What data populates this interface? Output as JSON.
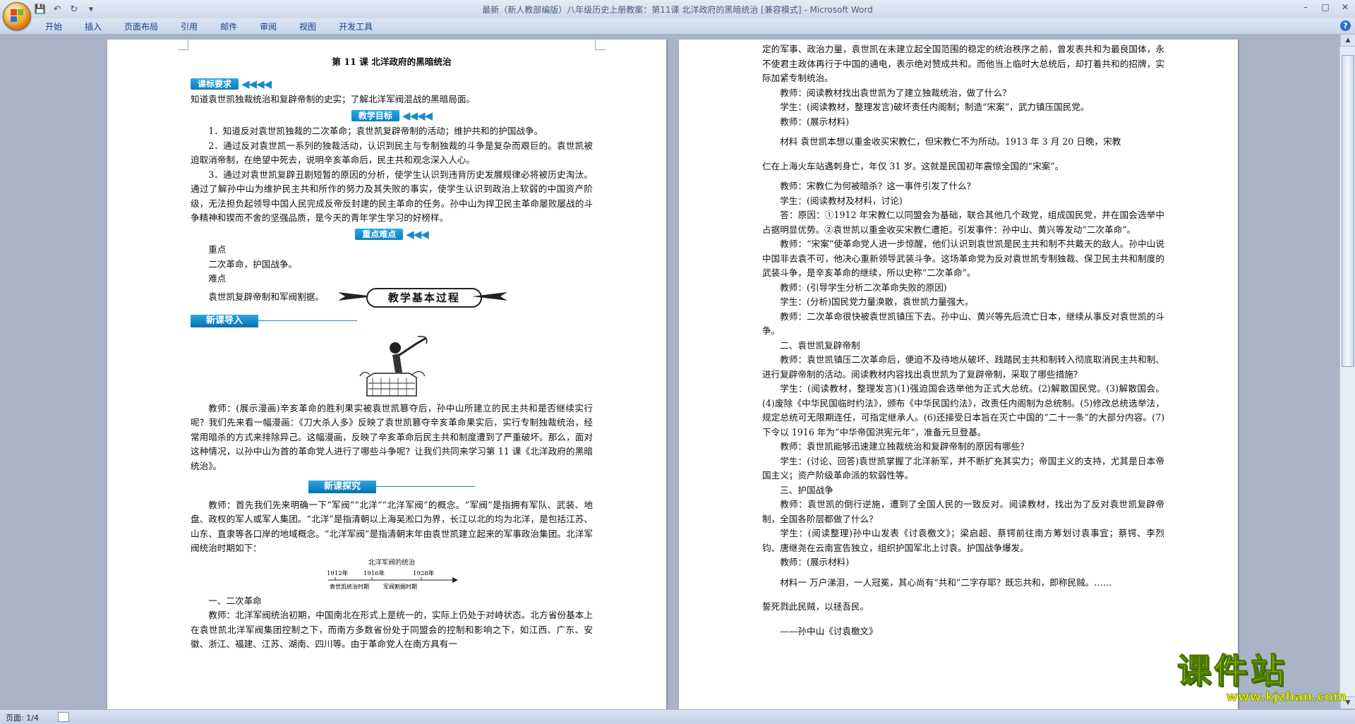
{
  "app": {
    "title": "最新（新人教部编版）八年级历史上册教案：第11课   北洋政府的黑暗统治 [兼容模式] - Microsoft Word"
  },
  "quick_access": [
    {
      "name": "save-icon",
      "glyph": "💾"
    },
    {
      "name": "undo-icon",
      "glyph": "↶"
    },
    {
      "name": "redo-icon",
      "glyph": "↻"
    },
    {
      "name": "customize-icon",
      "glyph": "▾"
    }
  ],
  "window_controls": [
    "–",
    "□",
    "✕"
  ],
  "ribbon_tabs": [
    "开始",
    "插入",
    "页面布局",
    "引用",
    "邮件",
    "审阅",
    "视图",
    "开发工具"
  ],
  "status": {
    "page": "页面: 1/4"
  },
  "watermark": {
    "text": "课件站",
    "url": "www.kjzhan.com"
  },
  "page1": {
    "title": "第 11 课    北洋政府的黑暗统治",
    "req_label": "课标要求",
    "req_text": "知道袁世凯独裁统治和复辟帝制的史实；了解北洋军阀混战的黑暗局面。",
    "goal_label": "教学目标",
    "goal_1": "1．知道反对袁世凯独裁的二次革命；袁世凯复辟帝制的活动；维护共和的护国战争。",
    "goal_2": "2．通过反对袁世凯一系列的独裁活动，认识到民主与专制独裁的斗争是复杂而艰巨的。袁世凯被迫取消帝制，在绝望中死去，说明辛亥革命后，民主共和观念深入人心。",
    "goal_3": "3．通过对袁世凯复辟丑剧短暂的原因的分析，使学生认识到违背历史发展规律必将被历史淘汰。通过了解孙中山为维护民主共和所作的努力及其失败的事实，使学生认识到政治上软弱的中国资产阶级，无法担负起领导中国人民完成反帝反封建的民主革命的任务。孙中山为捍卫民主革命屡败屡战的斗争精神和锲而不舍的坚强品质，是今天的青年学生学习的好榜样。",
    "key_label": "重点难点",
    "key_head": "重点",
    "key_text": "二次革命，护国战争。",
    "diff_head": "难点",
    "diff_text": "袁世凯复辟帝制和军阀割据。",
    "process_label": "教学基本过程",
    "intro_label": "新课导入",
    "intro_text": "教师：(展示漫画)辛亥革命的胜利果实被袁世凯篡夺后，孙中山所建立的民主共和是否继续实行呢？我们先来看一幅漫画：《刀大杀人多》反映了袁世凯篡夺辛亥革命果实后，实行专制独裁统治，经常用暗杀的方式来排除异己。这幅漫画，反映了辛亥革命后民主共和制度遭到了严重破坏。那么，面对这种情况，以孙中山为首的革命党人进行了哪些斗争呢？让我们共同来学习第 11 课《北洋政府的黑暗统治》。",
    "explore_label": "新课探究",
    "explore_text": "教师：首先我们先来明确一下“军阀”“北洋”“北洋军阀”的概念。“军阀”是指拥有军队、武装、地盘、政权的军人或军人集团。“北洋”是指清朝以上海吴淞口为界，长江以北的均为北洋，是包括江苏、山东、直隶等各口岸的地域概念。“北洋军阀”是指清朝末年由袁世凯建立起来的军事政治集团。北洋军阀统治时期如下：",
    "timeline_title": "北洋军阀的统治",
    "timeline_years": [
      "1912年",
      "1916年",
      "1928年"
    ],
    "timeline_periods": [
      "袁世凯统治时期",
      "军阀割据时期"
    ],
    "sec1_head": "一、二次革命",
    "sec1_text": "教师：北洋军阀统治初期，中国南北在形式上是统一的，实际上仍处于对峙状态。北方省份基本上在袁世凯北洋军阀集团控制之下，而南方多数省份处于同盟会的控制和影响之下，如江西、广东、安徽、浙江、福建、江苏、湖南、四川等。由于革命党人在南方具有一"
  },
  "page2": {
    "p1": "定的军事、政治力量，袁世凯在未建立起全国范围的稳定的统治秩序之前，曾发表共和为最良国体，永不使君主政体再行于中国的通电，表示绝对赞成共和。而他当上临时大总统后，却打着共和的招牌，实际加紧专制统治。",
    "q1": "教师：阅读教材找出袁世凯为了建立独裁统治，做了什么？",
    "a1": "学生：(阅读教材，整理发言)破坏责任内阁制；制造“宋案”，武力镇压国民党。",
    "t1": "教师：(展示材料)",
    "m1": "材料    袁世凯本想以重金收买宋教仁，但宋教仁不为所动。1913 年 3 月 20 日晚，宋教",
    "m1b": "仁在上海火车站遇刺身亡，年仅 31 岁。这就是民国初年震惊全国的“宋案”。",
    "q2": "教师：宋教仁为何被暗杀？这一事件引发了什么？",
    "a2": "学生：(阅读教材及材料，讨论)",
    "ans2": "答：原因：①1912 年宋教仁以同盟会为基础，联合其他几个政党，组成国民党，并在国会选举中占据明显优势。②袁世凯以重金收买宋教仁遭拒。引发事件：孙中山、黄兴等发动“二次革命”。",
    "t2": "教师：“宋案”使革命党人进一步惊醒，他们认识到袁世凯是民主共和制不共戴天的敌人。孙中山说中国非去袁不可，他决心重新领导武装斗争。这场革命党为反对袁世凯专制独裁、保卫民主共和制度的武装斗争，是辛亥革命的继续，所以史称“二次革命”。",
    "q3": "教师：(引导学生分析二次革命失败的原因)",
    "a3": "学生：(分析)国民党力量涣散，袁世凯力量强大。",
    "t3": "教师：二次革命很快被袁世凯镇压下去。孙中山、黄兴等先后流亡日本，继续从事反对袁世凯的斗争。",
    "sec2_head": "二、袁世凯复辟帝制",
    "t4": "教师：袁世凯镇压二次革命后，便迫不及待地从破坏、践踏民主共和制转入彻底取消民主共和制、进行复辟帝制的活动。阅读教材内容找出袁世凯为了复辟帝制，采取了哪些措施？",
    "a4": "学生：(阅读教材，整理发言)(1)强迫国会选举他为正式大总统。(2)解散国民党。(3)解散国会。(4)废除《中华民国临时约法》，颁布《中华民国约法》，改责任内阁制为总统制。(5)修改总统选举法，规定总统可无限期连任，可指定继承人。(6)还接受日本旨在灭亡中国的“二十一条”的大部分内容。(7)下令以 1916 年为“中华帝国洪宪元年”，准备元旦登基。",
    "q5": "教师：袁世凯能够迅速建立独裁统治和复辟帝制的原因有哪些？",
    "a5": "学生：(讨论、回答)袁世凯掌握了北洋新军，并不断扩充其实力；帝国主义的支持，尤其是日本帝国主义；资产阶级革命派的软弱性等。",
    "sec3_head": "三、护国战争",
    "t6": "教师：袁世凯的倒行逆施，遭到了全国人民的一致反对。阅读教材，找出为了反对袁世凯复辟帝制，全国各阶层都做了什么？",
    "a6": "学生：(阅读整理)孙中山发表《讨袁檄文》；梁启超、蔡锷前往南方筹划讨袁事宜；蔡锷、李烈钧、唐继尧在云南宣告独立，组织护国军北上讨袁。护国战争爆发。",
    "t7": "教师：(展示材料)",
    "m2": "材料一    万户涕泪，一人冠冕，其心尚有“共和”二字存耶？既忘共和，即称民贼。……",
    "m2b": "誓死戮此民贼，以拯吾民。",
    "m2src": "——孙中山《讨袁檄文》"
  }
}
